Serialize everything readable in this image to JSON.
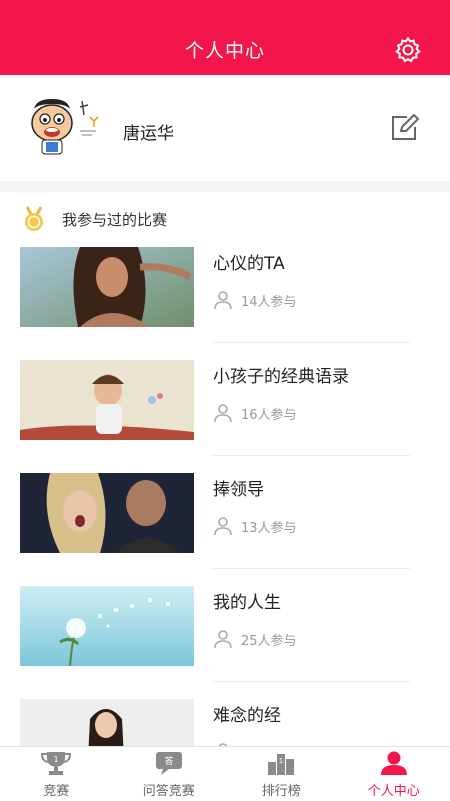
{
  "header": {
    "title": "个人中心",
    "icon": "gear-icon"
  },
  "profile": {
    "name": "唐运华",
    "edit_icon": "edit-icon",
    "avatar_icon": "cartoon-avatar"
  },
  "section": {
    "title": "我参与过的比赛",
    "icon": "medal-icon"
  },
  "competitions": [
    {
      "title": "心仪的TA",
      "participants": "14人参与"
    },
    {
      "title": "小孩子的经典语录",
      "participants": "16人参与"
    },
    {
      "title": "捧领导",
      "participants": "13人参与"
    },
    {
      "title": "我的人生",
      "participants": "25人参与"
    },
    {
      "title": "难念的经",
      "participants": ""
    }
  ],
  "tabbar": {
    "items": [
      {
        "label": "竞赛",
        "icon": "trophy-icon"
      },
      {
        "label": "问答竞赛",
        "icon": "qa-icon"
      },
      {
        "label": "排行榜",
        "icon": "ranking-icon"
      },
      {
        "label": "个人中心",
        "icon": "person-icon"
      }
    ],
    "active_index": 3
  },
  "colors": {
    "accent": "#f2164a",
    "muted": "#999999"
  }
}
